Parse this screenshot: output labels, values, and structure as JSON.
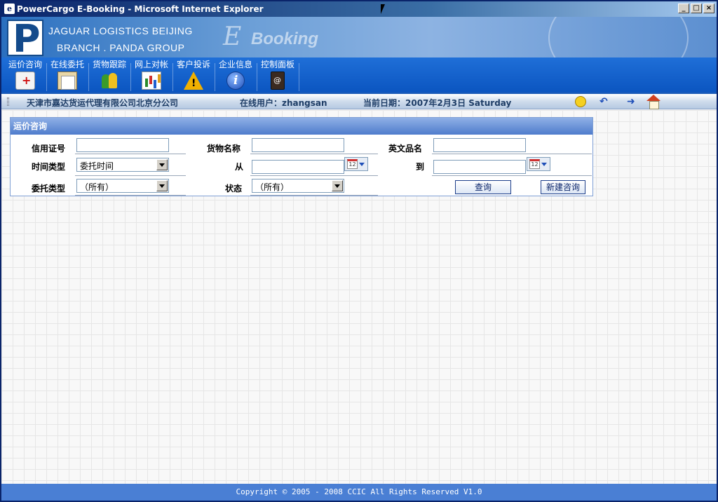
{
  "window": {
    "title": "PowerCargo E-Booking - Microsoft Internet Explorer",
    "icon": "ie-icon",
    "buttons": [
      "minimize",
      "maximize",
      "close"
    ]
  },
  "banner": {
    "logo_letter": "P",
    "company_line1": "JAGUAR LOGISTICS BEIJING",
    "company_line2": "BRANCH . PANDA GROUP",
    "ebooking_e": "E",
    "ebooking_word": "Booking"
  },
  "nav": {
    "items": [
      {
        "label": "运价咨询",
        "icon": "first-aid-kit-icon"
      },
      {
        "label": "在线委托",
        "icon": "clipboard-icon"
      },
      {
        "label": "货物跟踪",
        "icon": "people-icon"
      },
      {
        "label": "网上对帐",
        "icon": "bar-chart-icon"
      },
      {
        "label": "客户投诉",
        "icon": "warning-icon"
      },
      {
        "label": "企业信息",
        "icon": "info-icon"
      },
      {
        "label": "控制面板",
        "icon": "address-book-icon"
      }
    ]
  },
  "infobar": {
    "company": "天津市嘉达货运代理有限公司北京分公司",
    "online_user": "在线用户：zhangsan",
    "current_date": "当前日期：2007年2月3日 Saturday",
    "icons": [
      "chat-icon",
      "back-icon",
      "forward-icon",
      "home-icon"
    ]
  },
  "panel": {
    "title": "运价咨询",
    "fields": {
      "credit_no_label": "信用证号",
      "credit_no_value": "",
      "goods_name_label": "货物名称",
      "goods_name_value": "",
      "english_name_label": "英文品名",
      "english_name_value": "",
      "time_type_label": "时间类型",
      "time_type_value": "委托时间",
      "from_label": "从",
      "from_value": "",
      "to_label": "到",
      "to_value": "",
      "calendar_day": "12",
      "order_type_label": "委托类型",
      "order_type_value": "（所有）",
      "status_label": "状态",
      "status_value": "（所有）"
    },
    "buttons": {
      "query": "查询",
      "new_inquiry": "新建咨询"
    }
  },
  "footer": {
    "copyright": "Copyright © 2005 - 2008 CCIC All Rights Reserved V1.0"
  }
}
